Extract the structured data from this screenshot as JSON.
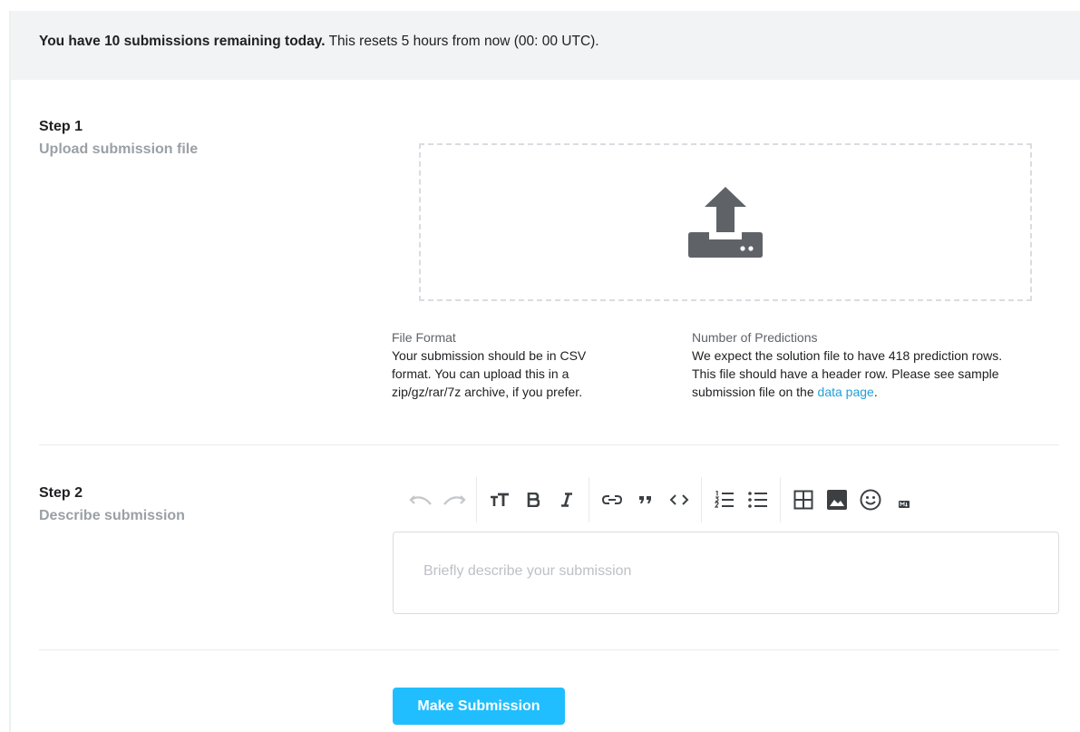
{
  "banner": {
    "bold_text": "You have 10 submissions remaining today.",
    "rest_text": " This resets 5 hours from now (00: 00 UTC)."
  },
  "step1": {
    "title": "Step 1",
    "subtitle": "Upload submission file",
    "upload_icon": "upload-icon",
    "file_format": {
      "label": "File Format",
      "lines": [
        "Your submission should be in CSV",
        "format. You can upload this in a",
        "zip/gz/rar/7z archive, if you prefer."
      ]
    },
    "predictions": {
      "label": "Number of Predictions",
      "lines": [
        "We expect the solution file to have 418 prediction rows.",
        "This file should have a header row. Please see sample"
      ],
      "last_line_prefix": "submission file on the ",
      "link_text": "data page",
      "last_line_suffix": "."
    }
  },
  "step2": {
    "title": "Step 2",
    "subtitle": "Describe submission",
    "toolbar_icons": [
      "undo-icon",
      "redo-icon",
      "text-size-icon",
      "bold-icon",
      "italic-icon",
      "link-icon",
      "quote-icon",
      "code-icon",
      "ordered-list-icon",
      "unordered-list-icon",
      "table-icon",
      "image-icon",
      "emoji-icon",
      "markdown-icon"
    ],
    "editor_placeholder": "Briefly describe your submission"
  },
  "actions": {
    "submit_label": "Make Submission"
  },
  "colors": {
    "accent": "#20beff",
    "link": "#20a0d8",
    "banner_bg": "#f1f3f4",
    "muted_text": "#9aa0a6"
  }
}
